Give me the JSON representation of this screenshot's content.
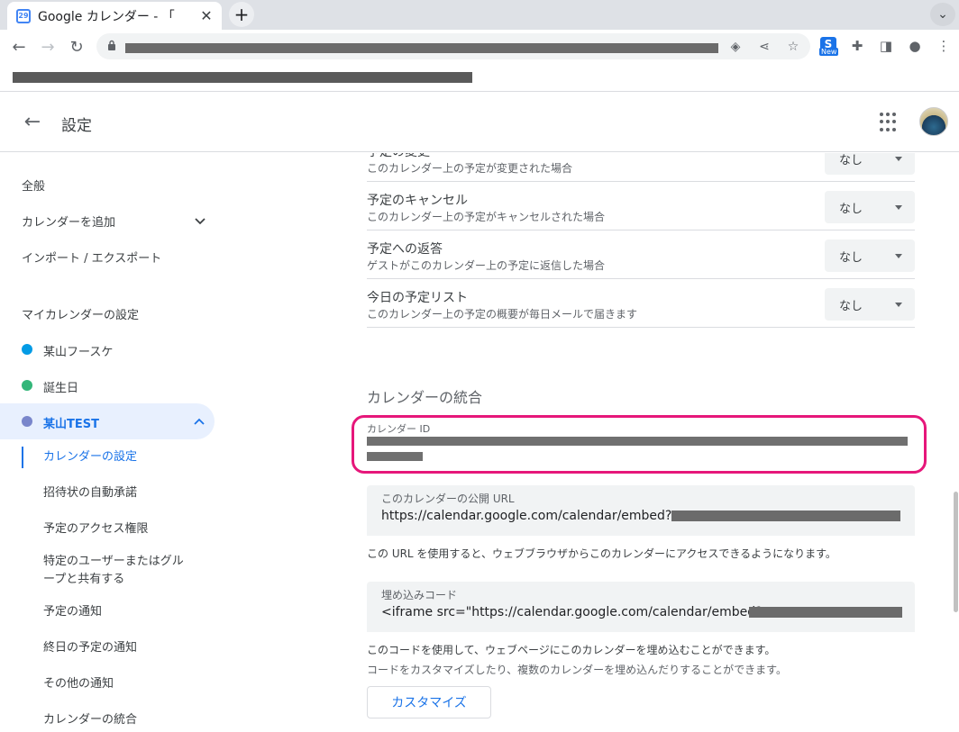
{
  "browser": {
    "tab_title": "Google カレンダー - 「",
    "favicon_text": "29",
    "close_glyph": "✕",
    "new_tab_glyph": "+",
    "ext_s_label": "S",
    "ext_new_label": "New"
  },
  "app": {
    "header_title": "設定",
    "back_glyph": "←"
  },
  "sidebar": {
    "general": "全般",
    "add_calendar": "カレンダーを追加",
    "import_export": "インポート / エクスポート",
    "my_calendar_settings": "マイカレンダーの設定",
    "calendars": [
      {
        "name": "某山フースケ",
        "color": "#039be5"
      },
      {
        "name": "誕生日",
        "color": "#33b679"
      },
      {
        "name": "某山TEST",
        "color": "#7986cb"
      }
    ],
    "subitems": [
      "カレンダーの設定",
      "招待状の自動承諾",
      "予定のアクセス権限",
      "特定のユーザーまたはグル",
      "ープと共有する",
      "予定の通知",
      "終日の予定の通知",
      "その他の通知",
      "カレンダーの統合"
    ]
  },
  "notifications": [
    {
      "title": "予定の変更",
      "subtitle": "このカレンダー上の予定が変更された場合",
      "value": "なし"
    },
    {
      "title": "予定のキャンセル",
      "subtitle": "このカレンダー上の予定がキャンセルされた場合",
      "value": "なし"
    },
    {
      "title": "予定への返答",
      "subtitle": "ゲストがこのカレンダー上の予定に返信した場合",
      "value": "なし"
    },
    {
      "title": "今日の予定リスト",
      "subtitle": "このカレンダー上の予定の概要が毎日メールで届きます",
      "value": "なし"
    }
  ],
  "integration": {
    "section_title": "カレンダーの統合",
    "calendar_id_label": "カレンダー ID",
    "public_url_label": "このカレンダーの公開 URL",
    "public_url_value": "https://calendar.google.com/calendar/embed?src=",
    "public_url_help": "この URL を使用すると、ウェブブラウザからこのカレンダーにアクセスできるようになります。",
    "embed_label": "埋め込みコード",
    "embed_value": "<iframe src=\"https://calendar.google.com/calendar/embed?src=",
    "embed_help": "このコードを使用して、ウェブページにこのカレンダーを埋め込むことができます。",
    "embed_help_sub": "コードをカスタマイズしたり、複数のカレンダーを埋め込んだりすることができます。",
    "customize_button": "カスタマイズ"
  },
  "colors": {
    "accent": "#1a73e8",
    "highlight": "#e6177a",
    "active_bg": "#e8f0fe"
  }
}
